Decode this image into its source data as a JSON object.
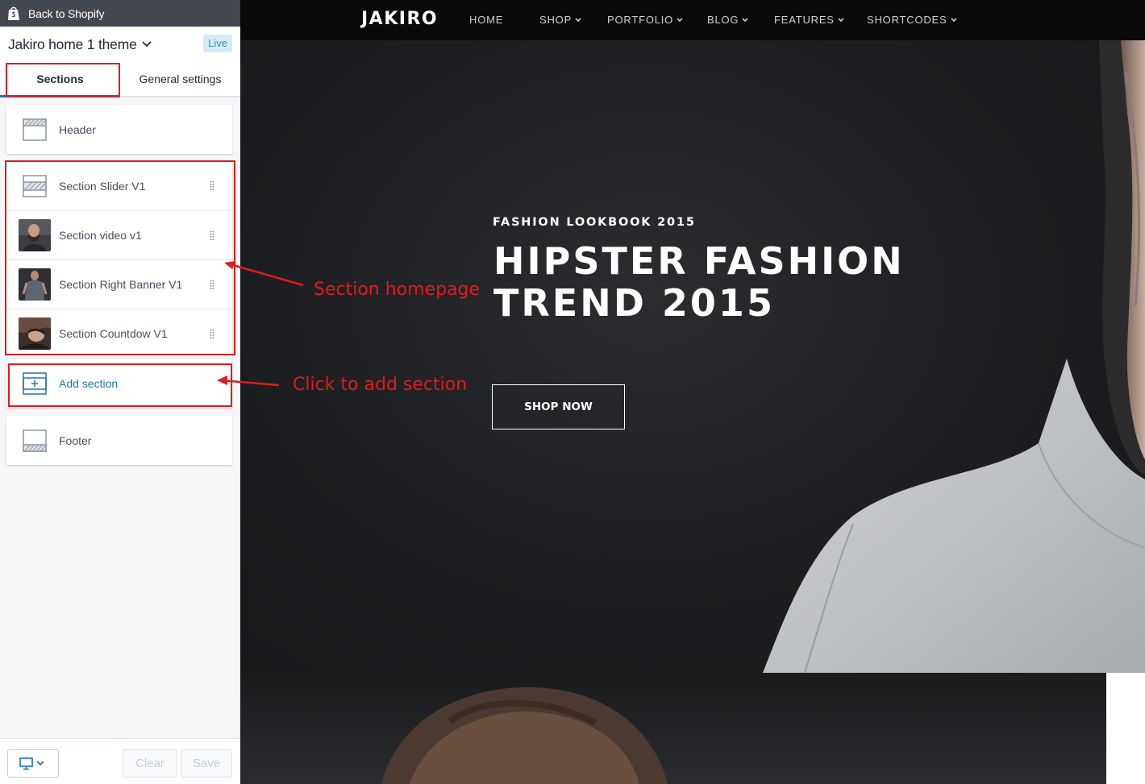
{
  "editor": {
    "back_label": "Back to Shopify",
    "theme_name": "Jakiro home 1 theme",
    "live_badge": "Live",
    "tabs": {
      "sections": "Sections",
      "general": "General settings"
    },
    "header_label": "Header",
    "sections": [
      {
        "label": "Section Slider V1",
        "icon": "slider-section-icon"
      },
      {
        "label": "Section video v1",
        "icon": "thumbnail"
      },
      {
        "label": "Section Right Banner V1",
        "icon": "thumbnail"
      },
      {
        "label": "Section Countdow V1",
        "icon": "thumbnail"
      }
    ],
    "add_section_label": "Add section",
    "footer_label": "Footer",
    "bottom": {
      "clear_label": "Clear",
      "save_label": "Save",
      "device_icon": "desktop-icon"
    }
  },
  "annotations": {
    "section_homepage": "Section homepage",
    "add_section_hint": "Click to add section",
    "color": "#e01b1b"
  },
  "preview": {
    "brand": "JAKIRO",
    "nav": [
      "HOME",
      "SHOP",
      "PORTFOLIO",
      "BLOG",
      "FEATURES",
      "SHORTCODES"
    ],
    "hero": {
      "eyebrow": "FASHION LOOKBOOK 2015",
      "title": "HIPSTER FASHION TREND 2015",
      "button": "SHOP NOW"
    }
  },
  "colors": {
    "accent": "#1a73b8",
    "topbar": "#43474e",
    "panel_bg": "#f4f6f8",
    "preview_bg": "#1b1c1f"
  }
}
